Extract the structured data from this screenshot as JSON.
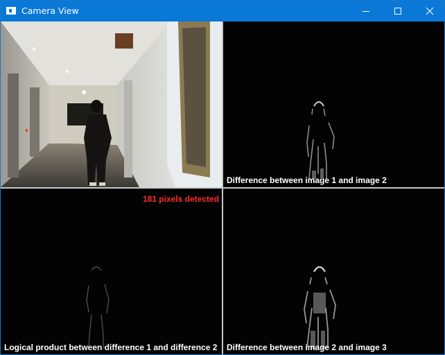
{
  "window": {
    "title": "Camera View",
    "controls": [
      "minimize-icon",
      "maximize-icon",
      "close-icon"
    ]
  },
  "panes": {
    "camera": {
      "caption": ""
    },
    "diff12": {
      "caption": "Difference between image 1 and image 2"
    },
    "logical": {
      "caption": "Logical product between difference 1 and difference 2",
      "status": "181 pixels detected"
    },
    "diff23": {
      "caption": "Difference between image 2 and image 3"
    }
  },
  "colors": {
    "titlebar": "#0a78d7",
    "status": "#ff2b2b",
    "caption": "#ffffff"
  }
}
